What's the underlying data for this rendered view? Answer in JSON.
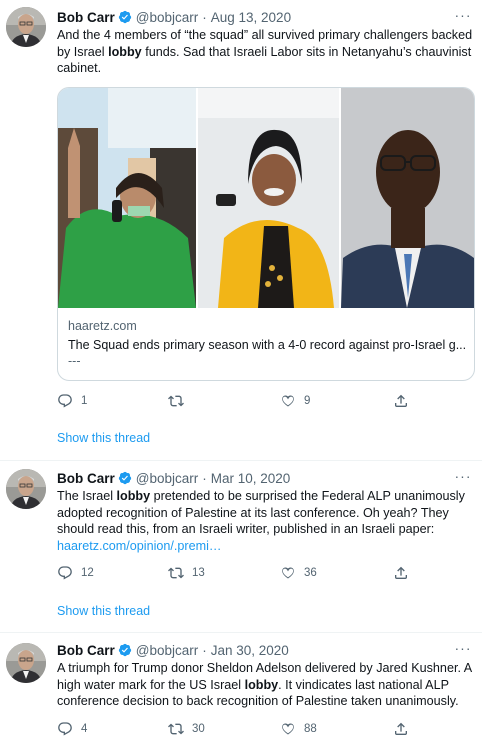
{
  "author": {
    "name": "Bob Carr",
    "handle": "@bobjcarr"
  },
  "colors": {
    "link": "#1d9bf0",
    "muted": "#536471",
    "text": "#0f1419"
  },
  "tweets": [
    {
      "date": "Aug 13, 2020",
      "text_a": "And the 4 members of “the squad” all survived primary challengers backed by Israel ",
      "text_b": "lobby",
      "text_c": " funds. Sad that Israeli Labor sits in Netanyahu’s chauvinist cabinet.",
      "card": {
        "domain": "haaretz.com",
        "title": "The Squad ends primary season with a 4-0 record against pro-Israel g...",
        "ellipsis": "---"
      },
      "replies": "1",
      "retweets": "",
      "likes": "9",
      "show_thread": "Show this thread"
    },
    {
      "date": "Mar 10, 2020",
      "text_a": "The Israel ",
      "text_b": "lobby",
      "text_c": " pretended to be surprised the Federal ALP unanimously adopted recognition of Palestine at its last conference. Oh yeah? They should read this, from an Israeli writer, published in an Israeli paper:",
      "link": "haaretz.com/opinion/.premi…",
      "replies": "12",
      "retweets": "13",
      "likes": "36",
      "show_thread": "Show this thread"
    },
    {
      "date": "Jan 30, 2020",
      "text_a": "A triumph for Trump donor Sheldon Adelson delivered by Jared Kushner. A high water mark for the US Israel ",
      "text_b": "lobby",
      "text_c": ". It vindicates last national ALP conference decision to back recognition of Palestine taken unanimously.",
      "replies": "4",
      "retweets": "30",
      "likes": "88"
    }
  ],
  "icons": [
    "verified-icon",
    "more-icon",
    "reply-icon",
    "retweet-icon",
    "like-icon",
    "share-icon"
  ]
}
